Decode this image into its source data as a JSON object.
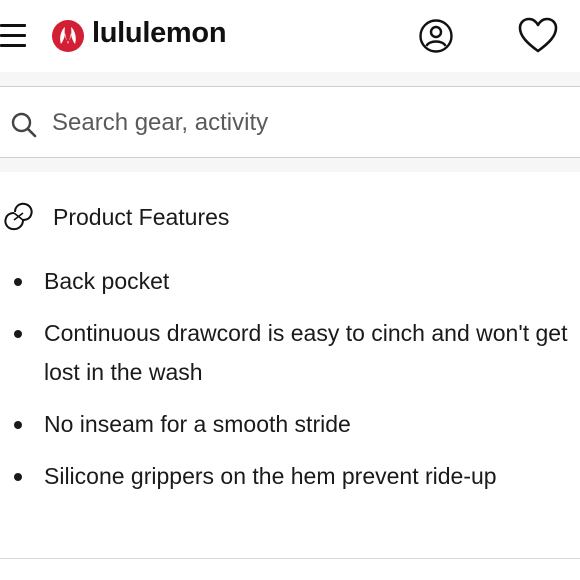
{
  "header": {
    "brand": "lululemon",
    "menu_icon": "hamburger-menu-icon",
    "logo_icon": "lululemon-logo-icon",
    "account_icon": "account-icon",
    "wishlist_icon": "heart-icon",
    "brand_color": "#d31f33"
  },
  "search": {
    "placeholder": "Search gear, activity",
    "value": "",
    "icon": "search-icon"
  },
  "product_features": {
    "title": "Product Features",
    "icon": "features-icon",
    "items": [
      "Back pocket",
      "Continuous drawcord is easy to cinch and won't get lost in the wash",
      "No inseam for a smooth stride",
      "Silicone grippers on the hem prevent ride-up"
    ]
  }
}
